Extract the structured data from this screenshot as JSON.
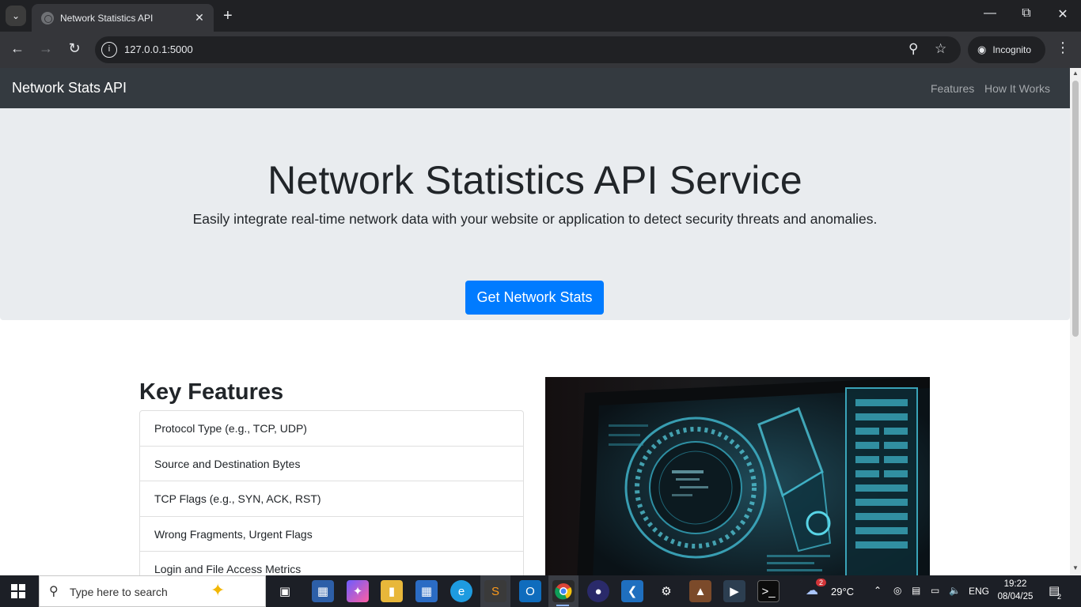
{
  "browser": {
    "tab_title": "Network Statistics API",
    "url": "127.0.0.1:5000",
    "incognito_label": "Incognito"
  },
  "site": {
    "brand": "Network Stats API",
    "nav": [
      "Features",
      "How It Works"
    ],
    "hero": {
      "title": "Network Statistics API Service",
      "lead": "Easily integrate real-time network data with your website or application to detect security threats and anomalies.",
      "cta": "Get Network Stats"
    },
    "features": {
      "heading": "Key Features",
      "items": [
        "Protocol Type (e.g., TCP, UDP)",
        "Source and Destination Bytes",
        "TCP Flags (e.g., SYN, ACK, RST)",
        "Wrong Fragments, Urgent Flags",
        "Login and File Access Metrics"
      ]
    }
  },
  "taskbar": {
    "search_placeholder": "Type here to search",
    "weather_temp": "29°C",
    "weather_badge": "2",
    "language": "ENG",
    "time": "19:22",
    "date": "08/04/25",
    "notification_count": "2"
  },
  "colors": {
    "navbar": "#343a40",
    "jumbotron": "#e9ecef",
    "primary": "#007bff"
  }
}
